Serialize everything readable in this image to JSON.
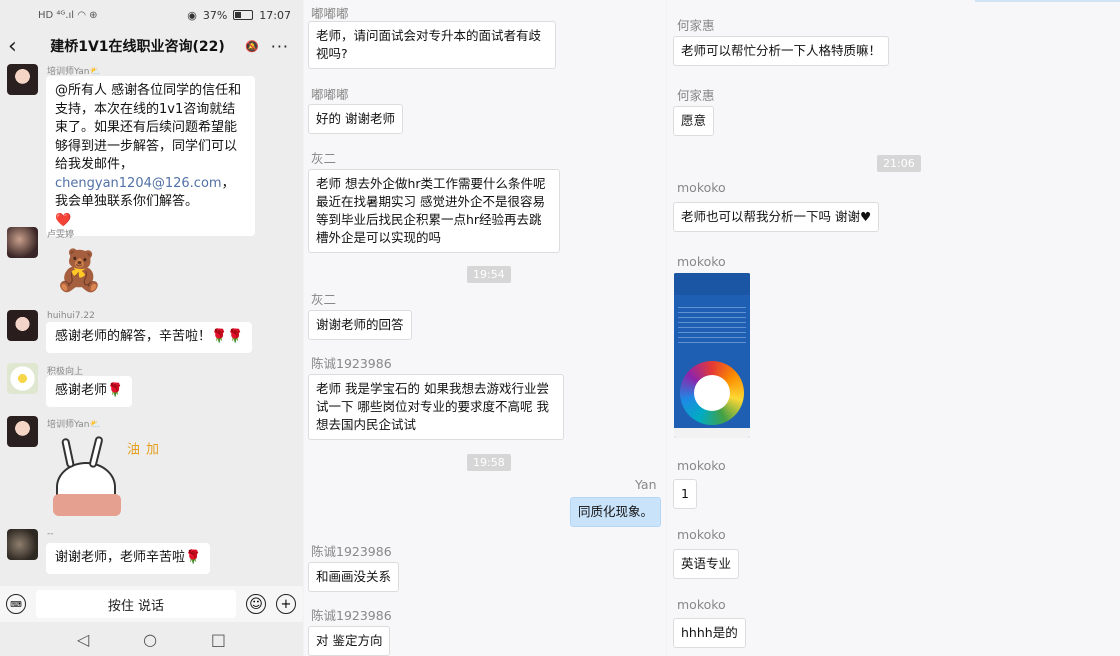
{
  "phone": {
    "status": {
      "network": "HD ⁴ᴳ.ıl ◠ ⊕",
      "battery": "37%",
      "time": "17:07"
    },
    "title": "建桥1V1在线职业咨询(22)",
    "messages": [
      {
        "name": "培训师Yan⛅",
        "text_a": "@所有人 感谢各位同学的信任和支持，本次在线的1v1咨询就结束了。如果还有后续问题希望能够得到进一步解答，同学们可以给我发邮件，",
        "email": "chengyan1204@126.com",
        "text_b": "，我会单独联系你们解答。",
        "emoji": "❤️"
      },
      {
        "name": "卢雯婷",
        "sticker": "🧸"
      },
      {
        "name": "huihui7.22",
        "text": "感谢老师的解答，辛苦啦！🌹🌹"
      },
      {
        "name": "积极向上",
        "text": "感谢老师🌹"
      },
      {
        "name": "培训师Yan⛅",
        "sticker": "🐰",
        "sticker_text": "加油"
      },
      {
        "name": "--",
        "text": "谢谢老师，老师辛苦啦🌹"
      }
    ],
    "input": {
      "hold_label": "按住 说话"
    }
  },
  "col1": {
    "items": [
      {
        "sender": "嘟嘟嘟",
        "text": "老师，请问面试会对专升本的面试者有歧视吗?"
      },
      {
        "sender": "嘟嘟嘟",
        "text": "好的 谢谢老师"
      },
      {
        "sender": "灰二",
        "text": "老师 想去外企做hr类工作需要什么条件呢 最近在找暑期实习 感觉进外企不是很容易 等到毕业后找民企积累一点hr经验再去跳槽外企是可以实现的吗"
      },
      {
        "time": "19:54"
      },
      {
        "sender": "灰二",
        "text": "谢谢老师的回答"
      },
      {
        "sender": "陈诚1923986",
        "text": "老师 我是学宝石的 如果我想去游戏行业尝试一下 哪些岗位对专业的要求度不高呢 我想去国内民企试试"
      },
      {
        "time": "19:58"
      },
      {
        "sender": "Yan",
        "text": "同质化现象。"
      },
      {
        "sender": "陈诚1923986",
        "text": "和画画没关系"
      },
      {
        "sender": "陈诚1923986",
        "text": "对 鉴定方向"
      }
    ]
  },
  "col2": {
    "items": [
      {
        "sender": "何家惠",
        "text": "老师可以帮忙分析一下人格特质嘛！"
      },
      {
        "sender": "何家惠",
        "text": "愿意"
      },
      {
        "time": "21:06"
      },
      {
        "sender": "mokoko",
        "text": "老师也可以帮我分析一下吗 谢谢♥"
      },
      {
        "sender": "mokoko",
        "image": "personality-test-screenshot"
      },
      {
        "sender": "mokoko",
        "text": "1"
      },
      {
        "sender": "mokoko",
        "text": "英语专业"
      },
      {
        "sender": "mokoko",
        "text": "hhhh是的"
      }
    ]
  }
}
